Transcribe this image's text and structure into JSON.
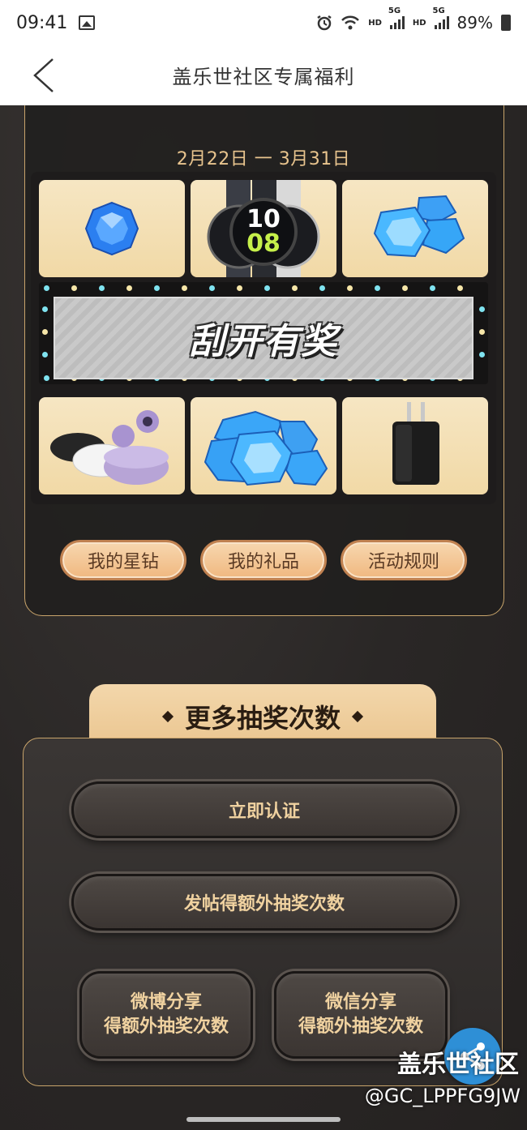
{
  "status_bar": {
    "time": "09:41",
    "hd1": "HD",
    "hd2": "HD",
    "net1": "5G",
    "net2": "5G",
    "battery": "89%"
  },
  "header": {
    "title": "盖乐世社区专属福利"
  },
  "event": {
    "date_range": "2月22日 一 3月31日",
    "scratch_label": "刮开有奖"
  },
  "actions": {
    "my_stars": "我的星钻",
    "my_gifts": "我的礼品",
    "rules": "活动规则"
  },
  "more_draws": {
    "title": "更多抽奖次数",
    "verify": "立即认证",
    "post": "发帖得额外抽奖次数",
    "weibo_line1": "微博分享",
    "weibo_line2": "得额外抽奖次数",
    "wechat_line1": "微信分享",
    "wechat_line2": "得额外抽奖次数"
  },
  "watermark": {
    "brand": "盖乐世社区",
    "user": "@GC_LPPFG9JW"
  },
  "watch_time": {
    "hour": "10",
    "minute": "08"
  },
  "colors": {
    "gold": "#e8c48e",
    "panel_border": "#c8a46b",
    "pill_fill": "#f0b880",
    "share_blue": "#2e8fd6"
  }
}
